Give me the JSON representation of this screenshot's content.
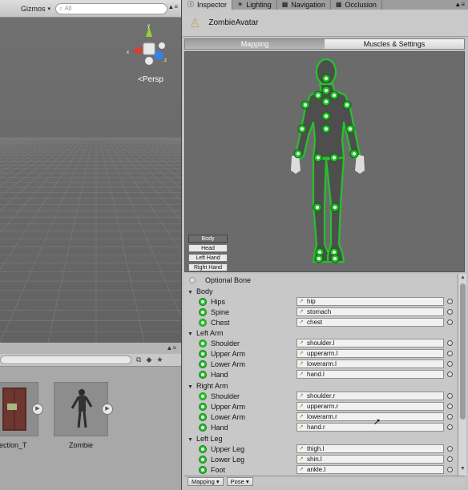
{
  "scene": {
    "gizmos_label": "Gizmos",
    "search_placeholder": "All",
    "persp_label": "Persp",
    "axis_labels": {
      "x": "x",
      "y": "y",
      "z": "z"
    }
  },
  "project": {
    "assets": [
      {
        "label": "section_T",
        "icon": "cabinet-model-icon"
      },
      {
        "label": "Zombie",
        "icon": "zombie-model-icon"
      }
    ]
  },
  "inspector": {
    "tabs": [
      {
        "label": "Inspector",
        "icon": "info-icon"
      },
      {
        "label": "Lighting",
        "icon": "light-icon"
      },
      {
        "label": "Navigation",
        "icon": "navigation-icon"
      },
      {
        "label": "Occlusion",
        "icon": "occlusion-icon"
      }
    ],
    "asset_name": "ZombieAvatar",
    "mode_tabs": [
      "Mapping",
      "Muscles & Settings"
    ],
    "body_part_buttons": [
      "Body",
      "Head",
      "Left Hand",
      "Right Hand"
    ],
    "optional_bone_label": "Optional Bone",
    "categories": {
      "body": "Body",
      "left_arm": "Left Arm",
      "right_arm": "Right Arm",
      "left_leg": "Left Leg"
    },
    "bones": [
      {
        "name": "Hips",
        "value": "hip"
      },
      {
        "name": "Spine",
        "value": "stomach"
      },
      {
        "name": "Chest",
        "value": "chest"
      },
      {
        "name": "Shoulder",
        "value": "shoulder.l"
      },
      {
        "name": "Upper Arm",
        "value": "upperarm.l"
      },
      {
        "name": "Lower Arm",
        "value": "lowerarm.l"
      },
      {
        "name": "Hand",
        "value": "hand.l"
      },
      {
        "name": "Shoulder",
        "value": "shoulder.r"
      },
      {
        "name": "Upper Arm",
        "value": "upperarm.r"
      },
      {
        "name": "Lower Arm",
        "value": "lowerarm.r"
      },
      {
        "name": "Hand",
        "value": "hand.r"
      },
      {
        "name": "Upper Leg",
        "value": "thigh.l"
      },
      {
        "name": "Lower Leg",
        "value": "shin.l"
      },
      {
        "name": "Foot",
        "value": "ankle.l"
      }
    ],
    "bottom_buttons": [
      "Mapping",
      "Pose"
    ]
  },
  "colors": {
    "bone_green": "#27c12b",
    "scene_gray": "#6f6f6f",
    "axis_y": "#8ed630",
    "axis_x": "#e23b2a",
    "axis_z": "#3a7fe0"
  }
}
